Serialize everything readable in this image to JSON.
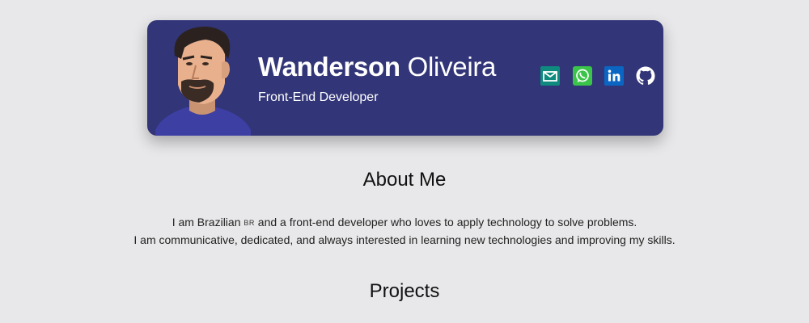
{
  "header": {
    "first_name": "Wanderson",
    "last_name": "Oliveira",
    "role": "Front-End Developer",
    "avatar": "cartoon-portrait",
    "card_color": "#323577",
    "social": [
      {
        "name": "email-icon",
        "color": "#0f8a7e"
      },
      {
        "name": "whatsapp-icon",
        "color": "#3ac449"
      },
      {
        "name": "linkedin-icon",
        "color": "#0a66c2"
      },
      {
        "name": "github-icon",
        "color": "#ffffff"
      }
    ]
  },
  "about": {
    "title": "About Me",
    "line1_before_flag": "I am Brazilian ",
    "flag": "BR",
    "line1_after_flag": " and a front-end developer who loves to apply technology to solve problems.",
    "line2": "I am communicative, dedicated, and always interested in learning new technologies and improving my skills."
  },
  "projects": {
    "title": "Projects"
  }
}
